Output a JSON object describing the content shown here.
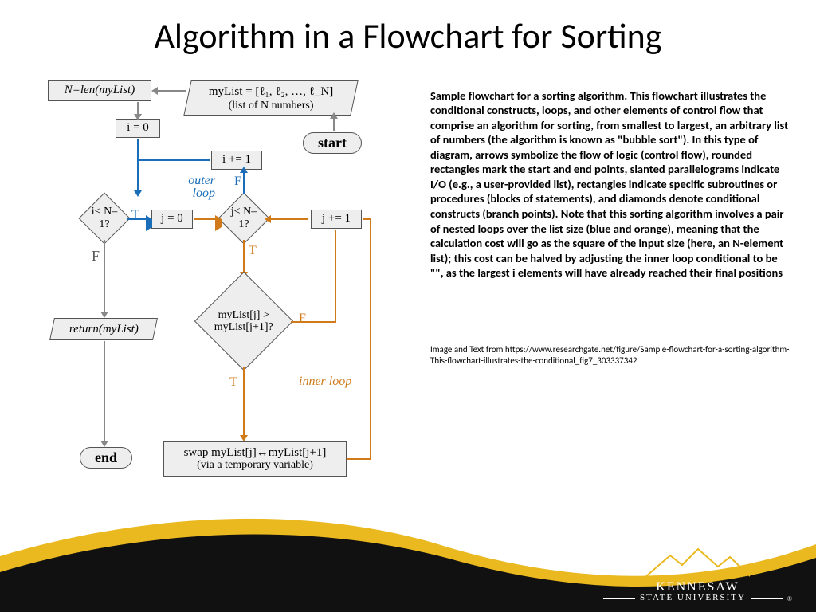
{
  "title": "Algorithm in a Flowchart for Sorting",
  "description": "Sample flowchart for a sorting algorithm. This flowchart illustrates the conditional constructs, loops, and other elements of control flow that comprise an algorithm for sorting, from smallest to largest, an arbitrary list of numbers (the algorithm is known as \"bubble sort\"). In this type of diagram, arrows symbolize the flow of logic (control flow), rounded rectangles mark the start and end points, slanted parallelograms indicate I/O (e.g., a user-provided list), rectangles indicate specific subroutines or procedures (blocks of statements), and diamonds denote conditional constructs (branch points). Note that this sorting algorithm involves a pair of nested loops over the list size (blue and orange), meaning that the calculation cost will go as the square of the input size (here, an N-element list); this cost can be halved by adjusting the inner loop conditional to be \"\", as the largest i elements will have already reached their final positions",
  "credit": "Image and Text from https://www.researchgate.net/figure/Sample-flowchart-for-a-sorting-algorithm-This-flowchart-illustrates-the-conditional_fig7_303337342",
  "flowchart": {
    "start": "start",
    "end": "end",
    "mylist": "myList = [ℓ₁, ℓ₂, …, ℓ_N]",
    "mylist_sub": "(list of N numbers)",
    "nlen": "N=len(myList)",
    "i0": "i = 0",
    "iinc": "i += 1",
    "j0": "j = 0",
    "jinc": "j += 1",
    "iless": "i< N–1?",
    "jless": "j< N–1?",
    "compare": "myList[j] > myList[j+1]?",
    "swap": "swap myList[j]↔myList[j+1]",
    "swap_sub": "(via a temporary variable)",
    "return": "return(myList)",
    "outer": "outer loop",
    "inner": "inner loop",
    "T": "T",
    "F": "F"
  },
  "logo": {
    "name": "KENNESAW",
    "sub": "STATE UNIVERSITY"
  }
}
